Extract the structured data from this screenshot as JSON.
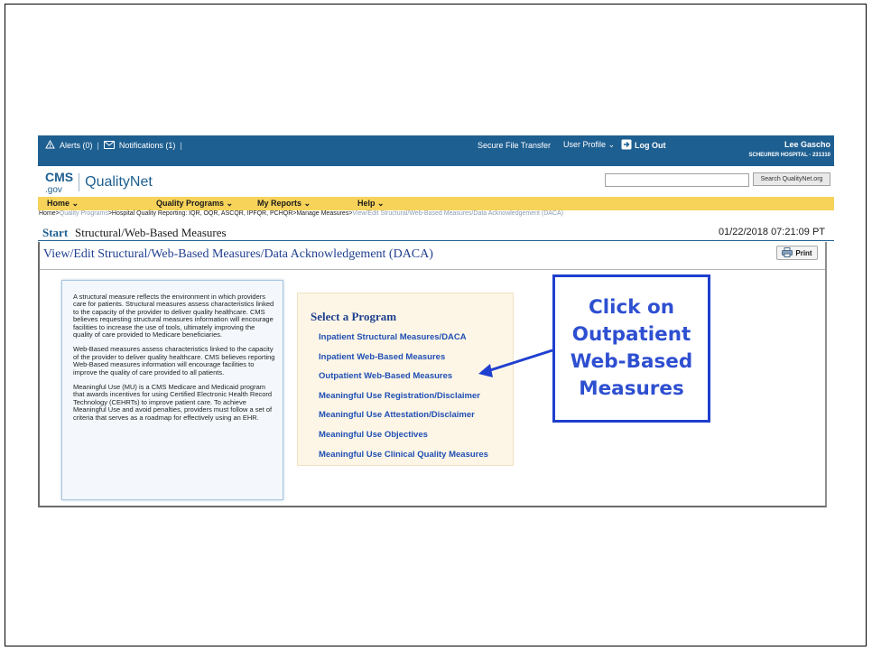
{
  "topbar": {
    "alerts": "Alerts (0)",
    "notifications": "Notifications (1)",
    "secure_file_transfer": "Secure File Transfer",
    "user_profile": "User Profile",
    "logout": "Log Out",
    "user_name": "Lee Gascho",
    "hospital": "SCHEURER HOSPITAL - 231310",
    "background_color": "#1e5f91"
  },
  "logo": {
    "cms": "CMS",
    "gov": ".gov",
    "brand": "QualityNet"
  },
  "search": {
    "value": "",
    "button_label": "Search QualityNet.org"
  },
  "nav": {
    "items": [
      {
        "label": "Home ⌄"
      },
      {
        "label": "Quality Programs ⌄"
      },
      {
        "label": "My Reports ⌄"
      },
      {
        "label": "Help ⌄"
      }
    ],
    "background_color": "#f7d35a"
  },
  "breadcrumb": {
    "prefix": "Home>",
    "quality_programs": "Quality Programs",
    "middle": ">Hospital Quality Reporting: IQR, OQR, ASCQR, IPFQR, PCHQR>Manage Measures>",
    "current": "View/Edit Structural/Web-Based Measures/Data Acknowledgement (DACA)"
  },
  "page": {
    "start": "Start",
    "title": "Structural/Web-Based Measures",
    "timestamp": "01/22/2018 07:21:09 PT",
    "subtitle": "View/Edit Structural/Web-Based Measures/Data Acknowledgement (DACA)",
    "print_label": "Print"
  },
  "info": {
    "paragraphs": [
      "A structural measure reflects the environment in which providers care for patients. Structural measures assess characteristics linked to the capacity of the provider to deliver quality healthcare. CMS believes requesting structural measures information will encourage facilities to increase the use of tools, ultimately improving the quality of care provided to Medicare beneficiaries.",
      "Web-Based measures assess characteristics linked to the capacity of the provider to deliver quality healthcare. CMS believes reporting Web-Based measures information will encourage facilities to improve the quality of care provided to all patients.",
      "Meaningful Use (MU) is a CMS Medicare and Medicaid program that awards incentives for using Certified Electronic Health Record Technology (CEHRTs) to improve patient care. To achieve Meaningful Use and avoid penalties, providers must follow a set of criteria that serves as a roadmap for effectively using an EHR."
    ]
  },
  "programs": {
    "heading": "Select a Program",
    "items": [
      {
        "label": "Inpatient Structural Measures/DACA"
      },
      {
        "label": "Inpatient Web-Based Measures"
      },
      {
        "label": "Outpatient Web-Based Measures"
      },
      {
        "label": "Meaningful Use Registration/Disclaimer"
      },
      {
        "label": "Meaningful Use Attestation/Disclaimer"
      },
      {
        "label": "Meaningful Use Objectives"
      },
      {
        "label": "Meaningful Use Clinical Quality Measures"
      }
    ]
  },
  "callout": {
    "lines": [
      "Click on",
      "Outpatient",
      "Web-Based",
      "Measures"
    ],
    "color": "#2e4fd0"
  }
}
